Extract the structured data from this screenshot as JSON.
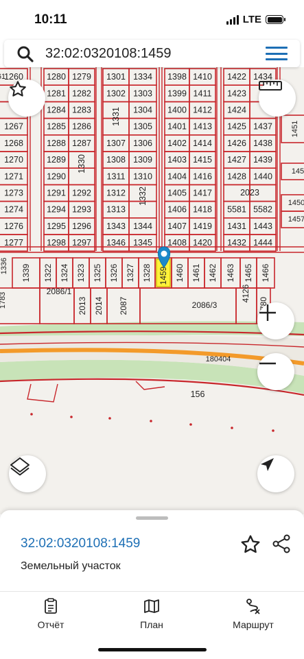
{
  "status": {
    "time": "10:11",
    "network": "LTE"
  },
  "search": {
    "query": "32:02:0320108:1459"
  },
  "map": {
    "row1": [
      [
        "1260",
        "1280",
        "1279",
        "1301",
        "1334",
        "1398",
        "1410",
        "1422",
        "1434"
      ],
      [
        "",
        "1281",
        "1282",
        "1302",
        "1303",
        "1399",
        "1411",
        "1423",
        ""
      ],
      [
        "",
        "1284",
        "1283",
        "",
        "1304",
        "1400",
        "1412",
        "1424",
        ""
      ],
      [
        "1267",
        "1285",
        "1286",
        "",
        "1305",
        "1401",
        "1413",
        "1425",
        "1437"
      ],
      [
        "1268",
        "1288",
        "1287",
        "1307",
        "1306",
        "1402",
        "1414",
        "1426",
        "1438"
      ],
      [
        "1270",
        "1289",
        "",
        "1308",
        "1309",
        "1403",
        "1415",
        "1427",
        "1439"
      ],
      [
        "1271",
        "1290",
        "",
        "1311",
        "1310",
        "1404",
        "1416",
        "1428",
        "1440"
      ],
      [
        "1273",
        "1291",
        "1292",
        "1312",
        "",
        "1405",
        "1417",
        "",
        ""
      ],
      [
        "1274",
        "1294",
        "1293",
        "1313",
        "",
        "1406",
        "1418",
        "5581",
        "5582"
      ],
      [
        "1276",
        "1295",
        "1296",
        "1343",
        "1344",
        "1407",
        "1419",
        "1431",
        "1443"
      ],
      [
        "1277",
        "1298",
        "1297",
        "1346",
        "1345",
        "1408",
        "1420",
        "1432",
        "1444"
      ]
    ],
    "vertical_labels": [
      "1331",
      "1330",
      "1332"
    ],
    "merged_2023": "2023",
    "edge_right": [
      "1451",
      "145",
      "1450",
      "1457"
    ],
    "row2": [
      "1339",
      "1322",
      "1324",
      "1323",
      "1325",
      "1326",
      "1327",
      "1328",
      "1459",
      "1460",
      "1461",
      "1462",
      "1463",
      "1465",
      "1466"
    ],
    "row3": [
      "1783",
      "2086/1",
      "2013",
      "2014",
      "2087",
      "2086/3",
      "4126",
      "780"
    ],
    "road_label": "180404",
    "parcel_156": "156",
    "edge_left_partial": [
      "61",
      "1336"
    ]
  },
  "sheet": {
    "cadastral_number": "32:02:0320108:1459",
    "parcel_type": "Земельный участок"
  },
  "tabs": [
    {
      "label": "Отчёт",
      "icon": "report-icon"
    },
    {
      "label": "План",
      "icon": "map-plan-icon"
    },
    {
      "label": "Маршрут",
      "icon": "route-icon"
    }
  ]
}
